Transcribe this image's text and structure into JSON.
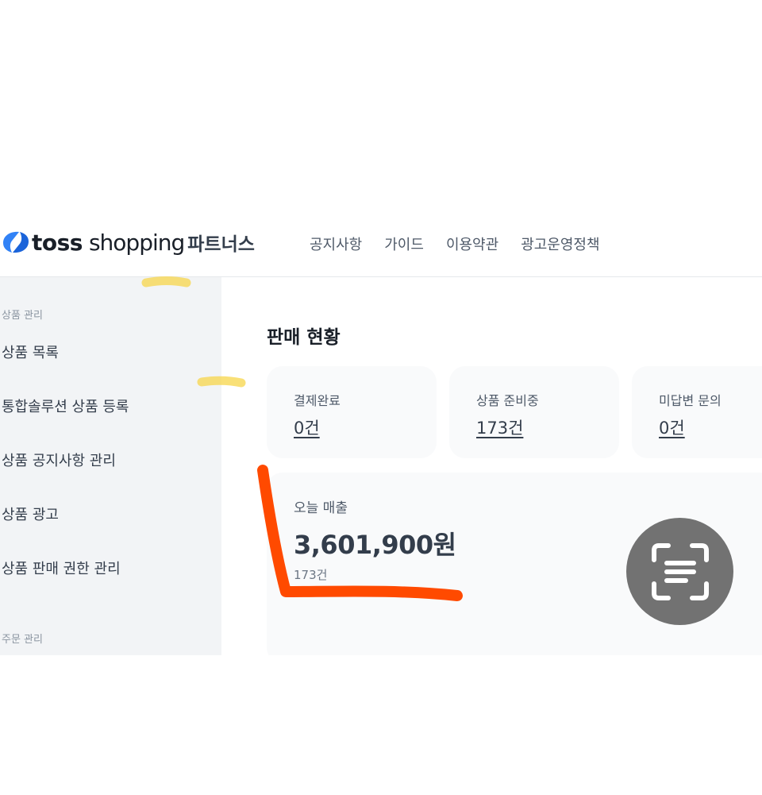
{
  "header": {
    "logo_toss": "toss",
    "logo_shopping": "shopping",
    "logo_partners": "파트너스",
    "nav": [
      "공지사항",
      "가이드",
      "이용약관",
      "광고운영정책"
    ]
  },
  "sidebar": {
    "section_product": "상품 관리",
    "items": [
      "상품 목록",
      "통합솔루션 상품 등록",
      "상품 공지사항 관리",
      "상품 광고",
      "상품 판매 권한 관리"
    ],
    "section_order": "주문 관리"
  },
  "main": {
    "title": "판매 현황",
    "cards": [
      {
        "label": "결제완료",
        "value": "0건"
      },
      {
        "label": "상품 준비중",
        "value": "173건"
      },
      {
        "label": "미답변 문의",
        "value": "0건"
      }
    ],
    "sales": {
      "label": "오늘 매출",
      "amount": "3,601,900원",
      "count": "173건"
    }
  },
  "colors": {
    "brand_blue": "#3182f6",
    "highlight_yellow": "#f7d64a",
    "annotation_orange": "#ff4a00",
    "lens_button": "#727272"
  },
  "icons": {
    "lens": "scan-text-icon"
  }
}
